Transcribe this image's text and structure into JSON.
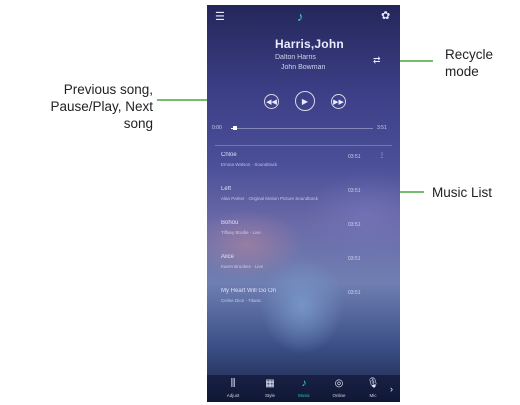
{
  "annotations": {
    "controls": [
      "Previous song,",
      "Pause/Play, Next",
      "song"
    ],
    "recycle": [
      "Recycle",
      "mode"
    ],
    "music_list": "Music List",
    "arrow_color": "#4aa63e"
  },
  "player": {
    "now_playing_title": "Harris,John",
    "now_playing_line1": "Dalton Harris",
    "now_playing_line2": "John Bowman",
    "time_elapsed": "0:00",
    "time_total": "3:51",
    "progress_fraction": 0.03,
    "accent_color": "#2de0c8"
  },
  "icons": {
    "menu": "menu-icon",
    "logo": "equalizer-logo-icon",
    "settings": "gear-icon",
    "repeat": "repeat-icon",
    "prev": "previous-icon",
    "play": "play-pause-icon",
    "next": "next-icon"
  },
  "music_list": [
    {
      "title": "Chloe",
      "subtitle": "Emma Watson · Soundtrack",
      "duration": "03:51"
    },
    {
      "title": "Left",
      "subtitle": "Alan Parker · Original Motion Picture Soundtrack",
      "duration": "03:51"
    },
    {
      "title": "Bohou",
      "subtitle": "Tiffany Brodie · Live",
      "duration": "03:51"
    },
    {
      "title": "Alice",
      "subtitle": "Karen Brookes · Live",
      "duration": "03:51"
    },
    {
      "title": "My Heart Will Go On",
      "subtitle": "Celine Dion · Titanic",
      "duration": "03:51"
    }
  ],
  "bottom_nav": [
    {
      "label": "Adjust",
      "icon": "sliders-icon"
    },
    {
      "label": "Style",
      "icon": "grid-icon"
    },
    {
      "label": "Music",
      "icon": "music-note-icon"
    },
    {
      "label": "Online",
      "icon": "radio-icon"
    },
    {
      "label": "Mic",
      "icon": "microphone-icon"
    }
  ]
}
